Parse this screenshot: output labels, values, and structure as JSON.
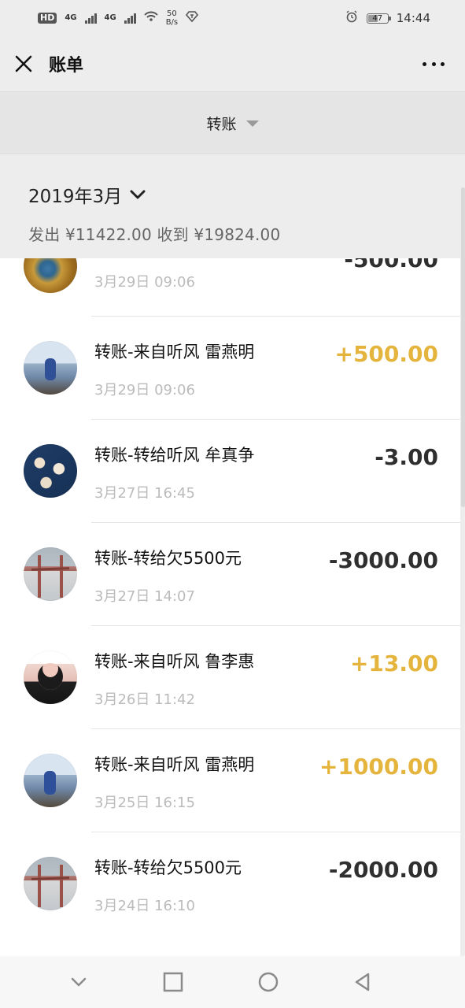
{
  "status_bar": {
    "hd": "HD",
    "network_1": "4G",
    "network_2": "4G",
    "speed_value": "50",
    "speed_unit": "B/s",
    "battery": "47",
    "time": "14:44"
  },
  "app_bar": {
    "title": "账单"
  },
  "filter": {
    "label": "转账"
  },
  "month": {
    "label": "2019年3月",
    "summary": "发出 ¥11422.00 收到 ¥19824.00"
  },
  "transactions": [
    {
      "title": "",
      "time": "3月29日 09:06",
      "amount": "-500.00"
    },
    {
      "title": "转账-来自听风 雷燕明",
      "time": "3月29日 09:06",
      "amount": "+500.00"
    },
    {
      "title": "转账-转给听风 牟真争",
      "time": "3月27日 16:45",
      "amount": "-3.00"
    },
    {
      "title": "转账-转给欠5500元",
      "time": "3月27日 14:07",
      "amount": "-3000.00"
    },
    {
      "title": "转账-来自听风 鲁李惠",
      "time": "3月26日 11:42",
      "amount": "+13.00"
    },
    {
      "title": "转账-来自听风 雷燕明",
      "time": "3月25日 16:15",
      "amount": "+1000.00"
    },
    {
      "title": "转账-转给欠5500元",
      "time": "3月24日 16:10",
      "amount": "-2000.00"
    }
  ]
}
